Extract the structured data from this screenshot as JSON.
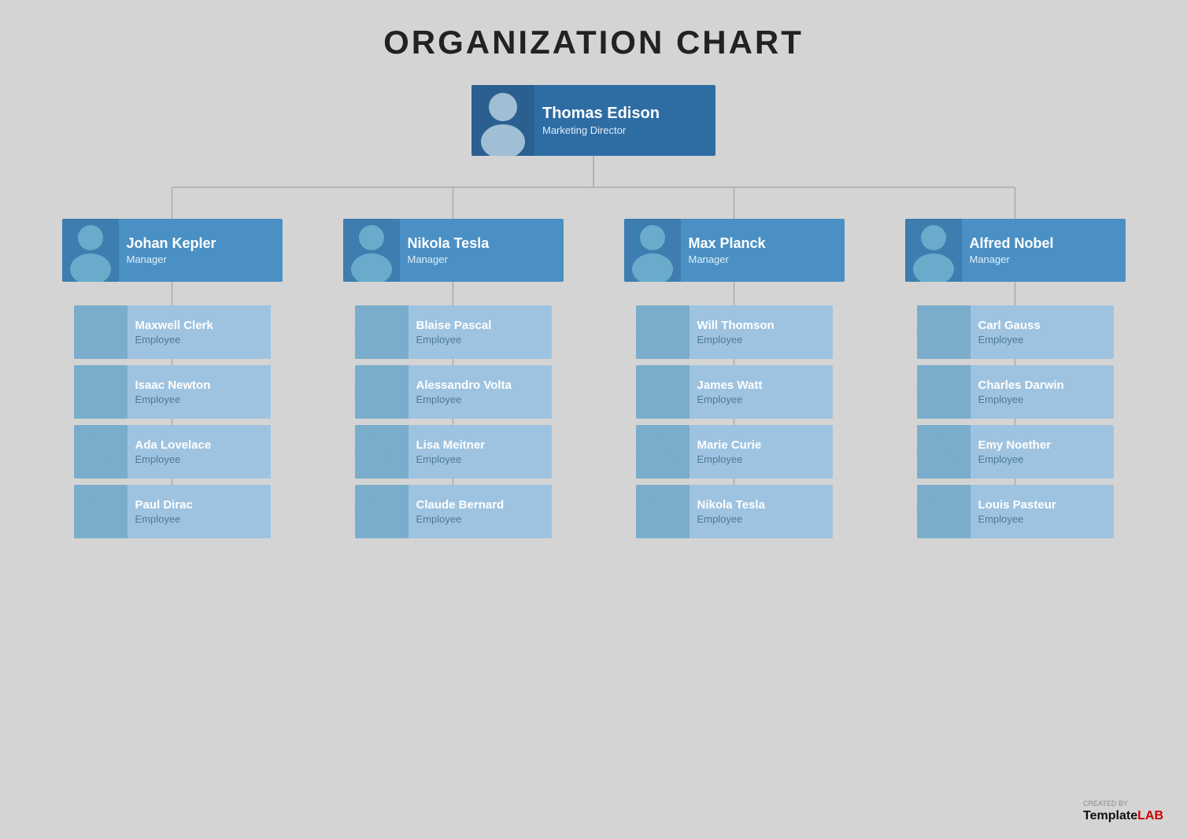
{
  "title": "ORGANIZATION CHART",
  "director": {
    "name": "Thomas Edison",
    "role": "Marketing Director"
  },
  "managers": [
    {
      "name": "Johan Kepler",
      "role": "Manager"
    },
    {
      "name": "Nikola Tesla",
      "role": "Manager"
    },
    {
      "name": "Max Planck",
      "role": "Manager"
    },
    {
      "name": "Alfred Nobel",
      "role": "Manager"
    }
  ],
  "employees": [
    [
      {
        "name": "Maxwell Clerk",
        "role": "Employee"
      },
      {
        "name": "Isaac Newton",
        "role": "Employee"
      },
      {
        "name": "Ada Lovelace",
        "role": "Employee"
      },
      {
        "name": "Paul Dirac",
        "role": "Employee"
      }
    ],
    [
      {
        "name": "Blaise Pascal",
        "role": "Employee"
      },
      {
        "name": "Alessandro Volta",
        "role": "Employee"
      },
      {
        "name": "Lisa Meitner",
        "role": "Employee"
      },
      {
        "name": "Claude Bernard",
        "role": "Employee"
      }
    ],
    [
      {
        "name": "Will Thomson",
        "role": "Employee"
      },
      {
        "name": "James Watt",
        "role": "Employee"
      },
      {
        "name": "Marie Curie",
        "role": "Employee"
      },
      {
        "name": "Nikola Tesla",
        "role": "Employee"
      }
    ],
    [
      {
        "name": "Carl Gauss",
        "role": "Employee"
      },
      {
        "name": "Charles Darwin",
        "role": "Employee"
      },
      {
        "name": "Emy Noether",
        "role": "Employee"
      },
      {
        "name": "Louis Pasteur",
        "role": "Employee"
      }
    ]
  ],
  "footer": {
    "created_by": "CREATED BY",
    "brand1": "Template",
    "brand2": "LAB"
  },
  "colors": {
    "director_bg": "#2e6da4",
    "manager_bg": "#4a90c4",
    "employee_bg": "#9ec3e0",
    "line": "#888"
  }
}
